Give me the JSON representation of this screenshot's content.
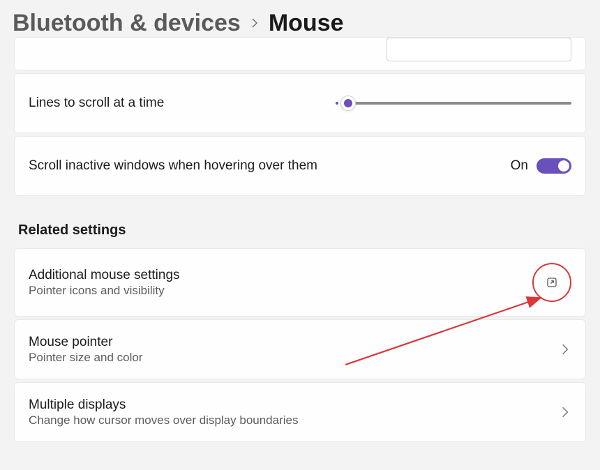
{
  "breadcrumb": {
    "parent": "Bluetooth & devices",
    "current": "Mouse"
  },
  "settings": {
    "scroll_wheel_partial": "",
    "lines_label": "Lines to scroll at a time",
    "scroll_inactive": {
      "label": "Scroll inactive windows when hovering over them",
      "state": "On"
    }
  },
  "related": {
    "section_title": "Related settings",
    "items": [
      {
        "title": "Additional mouse settings",
        "subtitle": "Pointer icons and visibility",
        "icon": "open-external"
      },
      {
        "title": "Mouse pointer",
        "subtitle": "Pointer size and color",
        "icon": "chevron"
      },
      {
        "title": "Multiple displays",
        "subtitle": "Change how cursor moves over display boundaries",
        "icon": "chevron"
      }
    ]
  },
  "colors": {
    "accent": "#6b4fbb",
    "annotation": "#d83838"
  }
}
